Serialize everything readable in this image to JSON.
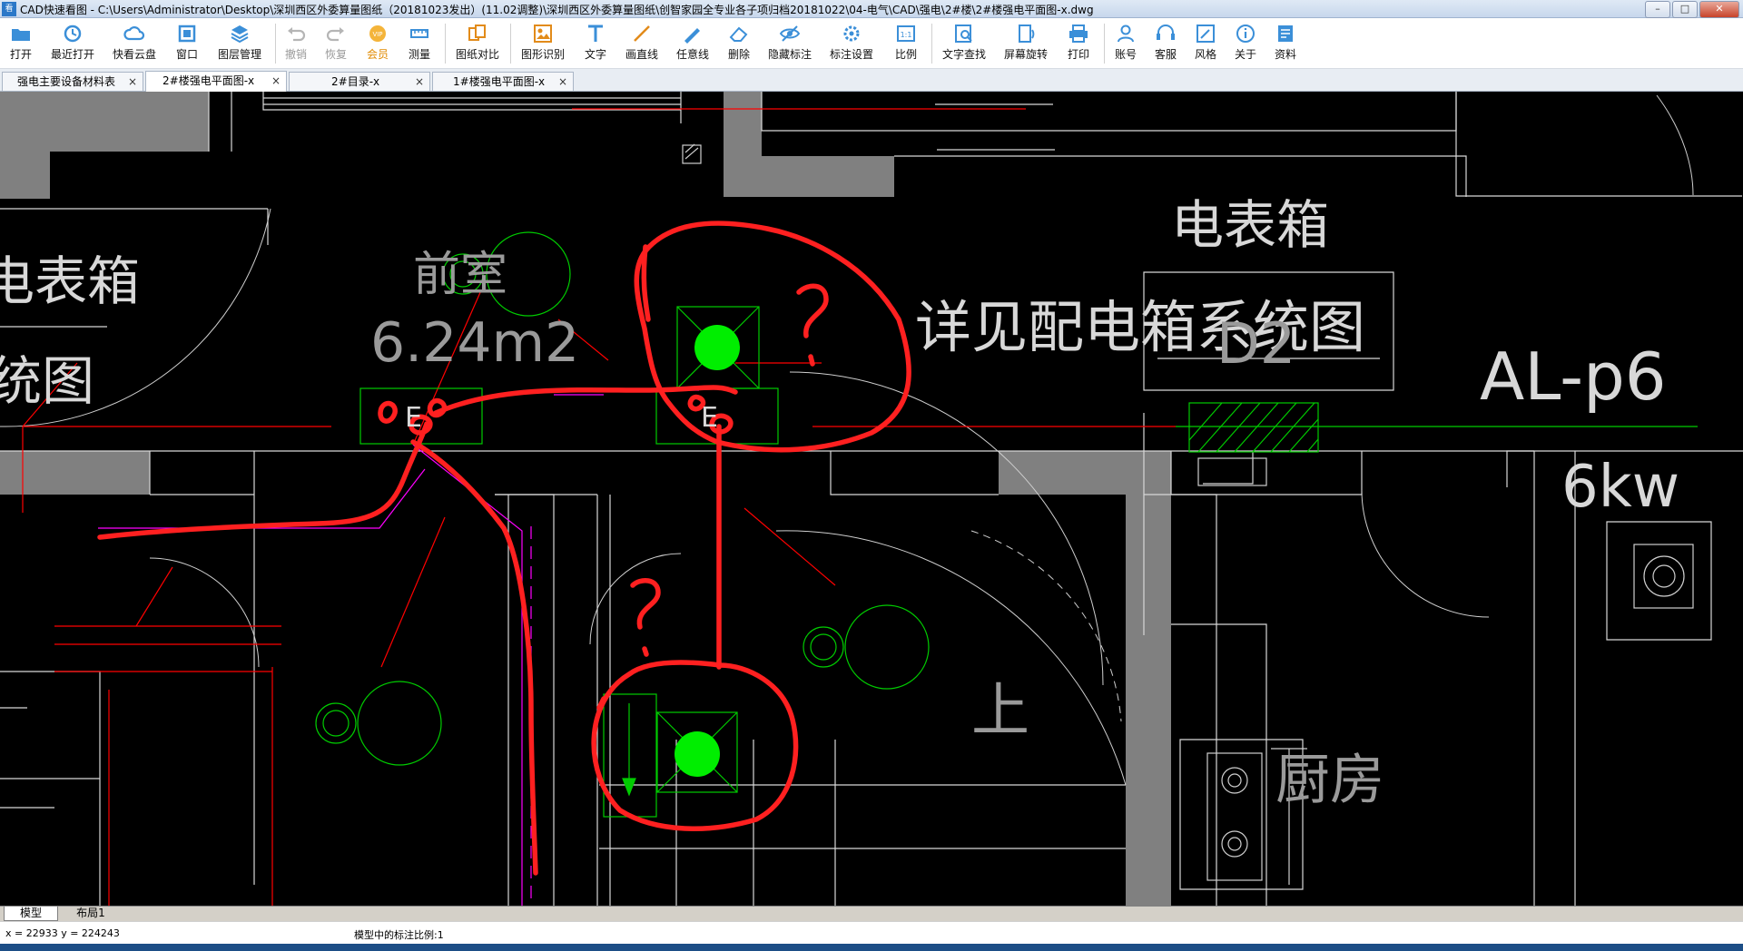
{
  "window": {
    "app_icon_text": "看图",
    "title": "CAD快速看图 - C:\\Users\\Administrator\\Desktop\\深圳西区外委算量图纸（20181023发出）(11.02调整)\\深圳西区外委算量图纸\\创智家园全专业各子项归档20181022\\04-电气\\CAD\\强电\\2#楼\\2#楼强电平面图-x.dwg",
    "minimize": "–",
    "maximize": "□",
    "close": "✕"
  },
  "toolbar": {
    "items": [
      {
        "label": "打开",
        "icon": "folder-icon"
      },
      {
        "label": "最近打开",
        "icon": "recent-icon"
      },
      {
        "label": "快看云盘",
        "icon": "cloud-icon"
      },
      {
        "label": "窗口",
        "icon": "window-icon"
      },
      {
        "label": "图层管理",
        "icon": "layers-icon"
      },
      {
        "label": "撤销",
        "icon": "undo-icon",
        "disabled": true
      },
      {
        "label": "恢复",
        "icon": "redo-icon",
        "disabled": true
      },
      {
        "label": "会员",
        "icon": "vip-icon"
      },
      {
        "label": "测量",
        "icon": "measure-icon"
      },
      {
        "label": "图纸对比",
        "icon": "compare-icon"
      },
      {
        "label": "图形识别",
        "icon": "recognize-icon"
      },
      {
        "label": "文字",
        "icon": "text-icon"
      },
      {
        "label": "画直线",
        "icon": "line-icon"
      },
      {
        "label": "任意线",
        "icon": "freehand-icon"
      },
      {
        "label": "删除",
        "icon": "eraser-icon"
      },
      {
        "label": "隐藏标注",
        "icon": "hide-annotation-icon"
      },
      {
        "label": "标注设置",
        "icon": "annotation-settings-icon"
      },
      {
        "label": "比例",
        "icon": "scale-icon"
      },
      {
        "label": "文字查找",
        "icon": "text-search-icon"
      },
      {
        "label": "屏幕旋转",
        "icon": "rotate-icon"
      },
      {
        "label": "打印",
        "icon": "print-icon"
      },
      {
        "label": "账号",
        "icon": "account-icon"
      },
      {
        "label": "客服",
        "icon": "support-icon"
      },
      {
        "label": "风格",
        "icon": "style-icon"
      },
      {
        "label": "关于",
        "icon": "info-icon"
      },
      {
        "label": "资料",
        "icon": "docs-icon"
      }
    ]
  },
  "tabs": [
    {
      "label": "强电主要设备材料表",
      "close": "×",
      "active": false
    },
    {
      "label": "2#楼强电平面图-x",
      "close": "×",
      "active": true
    },
    {
      "label": "2#目录-x",
      "close": "×",
      "active": false
    },
    {
      "label": "1#楼强电平面图-x",
      "close": "×",
      "active": false
    }
  ],
  "drawing": {
    "texts": {
      "meter_box_left": "电表箱",
      "system_left": "统图",
      "vestibule": "前室",
      "area": "6.24m2",
      "meter_box_right": "电表箱",
      "see_system": "详见配电箱系统图",
      "d2": "D2",
      "panel_id": "AL-p6",
      "power": "6kw",
      "up": "上",
      "kitchen": "厨房",
      "e_left": "E",
      "e_mid": "E"
    },
    "annotations": {
      "question_top": "?",
      "question_bottom": "?"
    },
    "colors": {
      "background": "#000000",
      "wall": "#808080",
      "line": "#ffffff",
      "green": "#00cc00",
      "red_cad": "#ff0000",
      "markup": "#ff2020",
      "magenta": "#ff00ff"
    }
  },
  "bottom_tabs": [
    {
      "label": "模型",
      "active": true
    },
    {
      "label": "布局1",
      "active": false
    }
  ],
  "status": {
    "coordinates": "x = 22933  y = 224243",
    "scale_text": "模型中的标注比例:1"
  }
}
